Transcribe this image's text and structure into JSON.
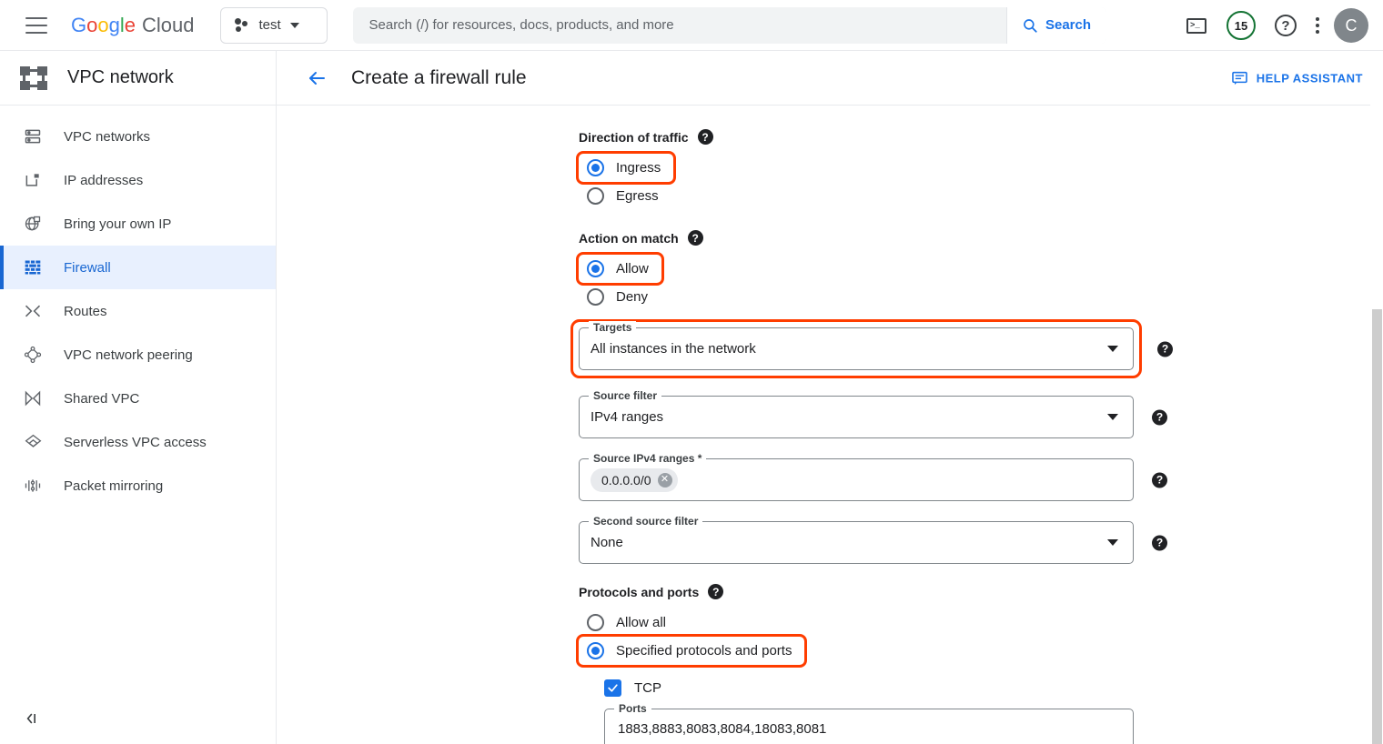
{
  "topbar": {
    "menu_icon": "hamburger-icon",
    "logo": {
      "word1": "Google",
      "word2": "Cloud"
    },
    "project": {
      "label": "test",
      "icon": "project-dots-icon"
    },
    "search": {
      "placeholder": "Search (/) for resources, docs, products, and more",
      "value": "",
      "button_label": "Search",
      "button_icon": "search-icon"
    },
    "actions": {
      "cloud_shell_icon": "terminal-icon",
      "credits_badge": "15",
      "credits_color": "#137333",
      "help_icon": "question-circle-icon",
      "more_icon": "kebab-menu-icon",
      "avatar_initial": "C"
    }
  },
  "sidebar": {
    "header": {
      "title": "VPC network",
      "icon": "vpc-network-icon"
    },
    "items": [
      {
        "label": "VPC networks",
        "icon": "vpc-networks-icon",
        "active": false
      },
      {
        "label": "IP addresses",
        "icon": "ip-addresses-icon",
        "active": false
      },
      {
        "label": "Bring your own IP",
        "icon": "bring-your-own-ip-icon",
        "active": false
      },
      {
        "label": "Firewall",
        "icon": "firewall-icon",
        "active": true
      },
      {
        "label": "Routes",
        "icon": "routes-icon",
        "active": false
      },
      {
        "label": "VPC network peering",
        "icon": "vpc-network-peering-icon",
        "active": false
      },
      {
        "label": "Shared VPC",
        "icon": "shared-vpc-icon",
        "active": false
      },
      {
        "label": "Serverless VPC access",
        "icon": "serverless-vpc-access-icon",
        "active": false
      },
      {
        "label": "Packet mirroring",
        "icon": "packet-mirroring-icon",
        "active": false
      }
    ],
    "collapse_label": "",
    "collapse_icon": "collapse-panel-icon",
    "active_color": "#1967d2",
    "active_bg": "#e8f0fe"
  },
  "main": {
    "back_icon": "back-arrow-icon",
    "title": "Create a firewall rule",
    "help_assistant": {
      "label": "HELP ASSISTANT",
      "icon": "chat-bubble-icon"
    }
  },
  "form": {
    "highlight_color": "#ff3d00",
    "direction": {
      "label": "Direction of traffic",
      "help_icon": "help-icon",
      "options": [
        {
          "label": "Ingress",
          "selected": true,
          "highlighted": true
        },
        {
          "label": "Egress",
          "selected": false,
          "highlighted": false
        }
      ]
    },
    "action": {
      "label": "Action on match",
      "help_icon": "help-icon",
      "options": [
        {
          "label": "Allow",
          "selected": true,
          "highlighted": true
        },
        {
          "label": "Deny",
          "selected": false,
          "highlighted": false
        }
      ]
    },
    "targets": {
      "legend": "Targets",
      "value": "All instances in the network",
      "highlighted": true,
      "caret_icon": "chevron-down-icon",
      "help_icon": "help-icon"
    },
    "source_filter": {
      "legend": "Source filter",
      "value": "IPv4 ranges",
      "caret_icon": "chevron-down-icon",
      "help_icon": "help-icon"
    },
    "source_ipv4_ranges": {
      "legend": "Source IPv4 ranges *",
      "chips": [
        {
          "label": "0.0.0.0/0",
          "remove_icon": "chip-remove-icon"
        }
      ],
      "help_icon": "help-icon"
    },
    "second_source_filter": {
      "legend": "Second source filter",
      "value": "None",
      "caret_icon": "chevron-down-icon",
      "help_icon": "help-icon"
    },
    "protocols_ports": {
      "label": "Protocols and ports",
      "help_icon": "help-icon",
      "options": [
        {
          "label": "Allow all",
          "selected": false,
          "highlighted": false
        },
        {
          "label": "Specified protocols and ports",
          "selected": true,
          "highlighted": true
        }
      ],
      "tcp": {
        "label": "TCP",
        "checked": true,
        "check_icon": "checkmark-icon",
        "ports_legend": "Ports",
        "ports_value": "1883,8883,8083,8084,18083,8081"
      }
    }
  }
}
